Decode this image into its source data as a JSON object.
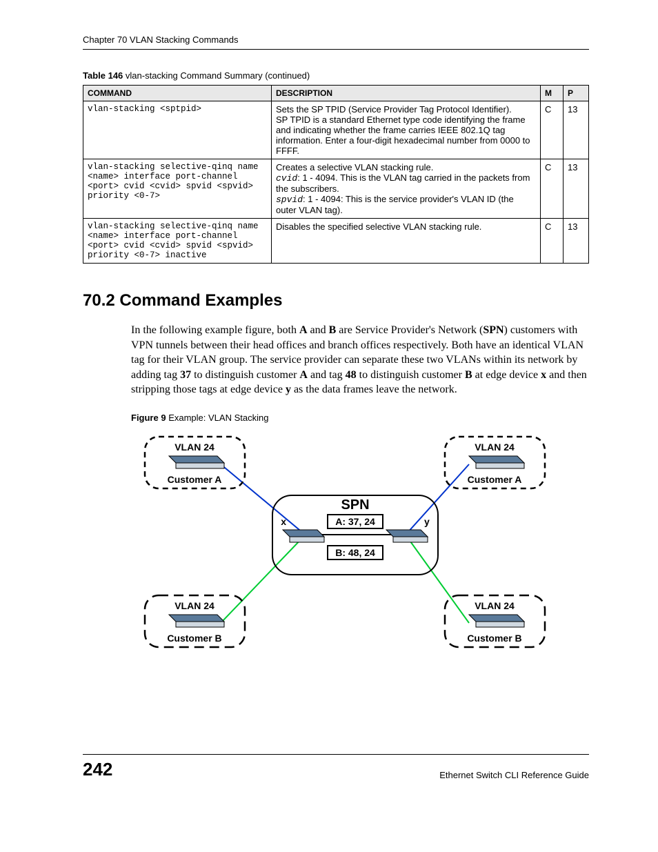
{
  "header": {
    "chapter": "Chapter 70 VLAN Stacking Commands"
  },
  "table": {
    "caption_bold": "Table 146",
    "caption_rest": "   vlan-stacking Command Summary (continued)",
    "headers": {
      "c0": "COMMAND",
      "c1": "DESCRIPTION",
      "c2": "M",
      "c3": "P"
    },
    "rows": [
      {
        "cmd": "vlan-stacking <sptpid>",
        "desc_line1": "Sets the SP TPID (Service Provider Tag Protocol Identifier).",
        "desc_rest": "SP TPID is a standard Ethernet type code identifying the frame and indicating whether the frame carries IEEE 802.1Q tag information. Enter a four-digit hexadecimal number from 0000 to FFFF.",
        "m": "C",
        "p": "13"
      },
      {
        "cmd": "vlan-stacking selective-qinq name <name> interface port-channel <port> cvid <cvid> spvid <spvid> priority <0-7>",
        "desc_line1": "Creates a selective VLAN stacking rule.",
        "desc_kv1_k": "cvid",
        "desc_kv1_v": ": 1 - 4094. This is the VLAN tag carried in the packets from the subscribers.",
        "desc_kv2_k": "spvid",
        "desc_kv2_v": ": 1 - 4094: This is the service provider's VLAN ID (the outer VLAN tag).",
        "m": "C",
        "p": "13"
      },
      {
        "cmd": "vlan-stacking selective-qinq name <name> interface port-channel <port> cvid <cvid> spvid <spvid> priority <0-7> inactive",
        "desc_line1": "Disables the specified selective VLAN stacking rule.",
        "m": "C",
        "p": "13"
      }
    ]
  },
  "section": {
    "heading": "70.2  Command Examples",
    "p1_a": "In the following example figure, both ",
    "p1_b1": "A",
    "p1_c": " and ",
    "p1_b2": "B",
    "p1_d": " are Service Provider's Network (",
    "p1_b3": "SPN",
    "p1_e": ") customers with VPN tunnels between their head offices and branch offices respectively. Both have an identical VLAN tag for their VLAN group. The service provider can separate these two VLANs within its network by adding tag ",
    "p1_b4": "37",
    "p1_f": " to distinguish customer ",
    "p1_b5": "A",
    "p1_g": " and tag ",
    "p1_b6": "48",
    "p1_h": " to distinguish customer ",
    "p1_b7": "B",
    "p1_i": " at edge device ",
    "p1_b8": "x",
    "p1_j": " and then stripping those tags at edge device ",
    "p1_b9": "y",
    "p1_k": " as the data frames leave the network."
  },
  "figure": {
    "caption_bold": "Figure 9",
    "caption_rest": "   Example: VLAN Stacking",
    "labels": {
      "vlan24": "VLAN 24",
      "custA": "Customer A",
      "custB": "Customer B",
      "spn": "SPN",
      "x": "x",
      "y": "y",
      "a_tag": "A: 37, 24",
      "b_tag": "B: 48, 24"
    }
  },
  "footer": {
    "page": "242",
    "title": "Ethernet Switch CLI Reference Guide"
  }
}
